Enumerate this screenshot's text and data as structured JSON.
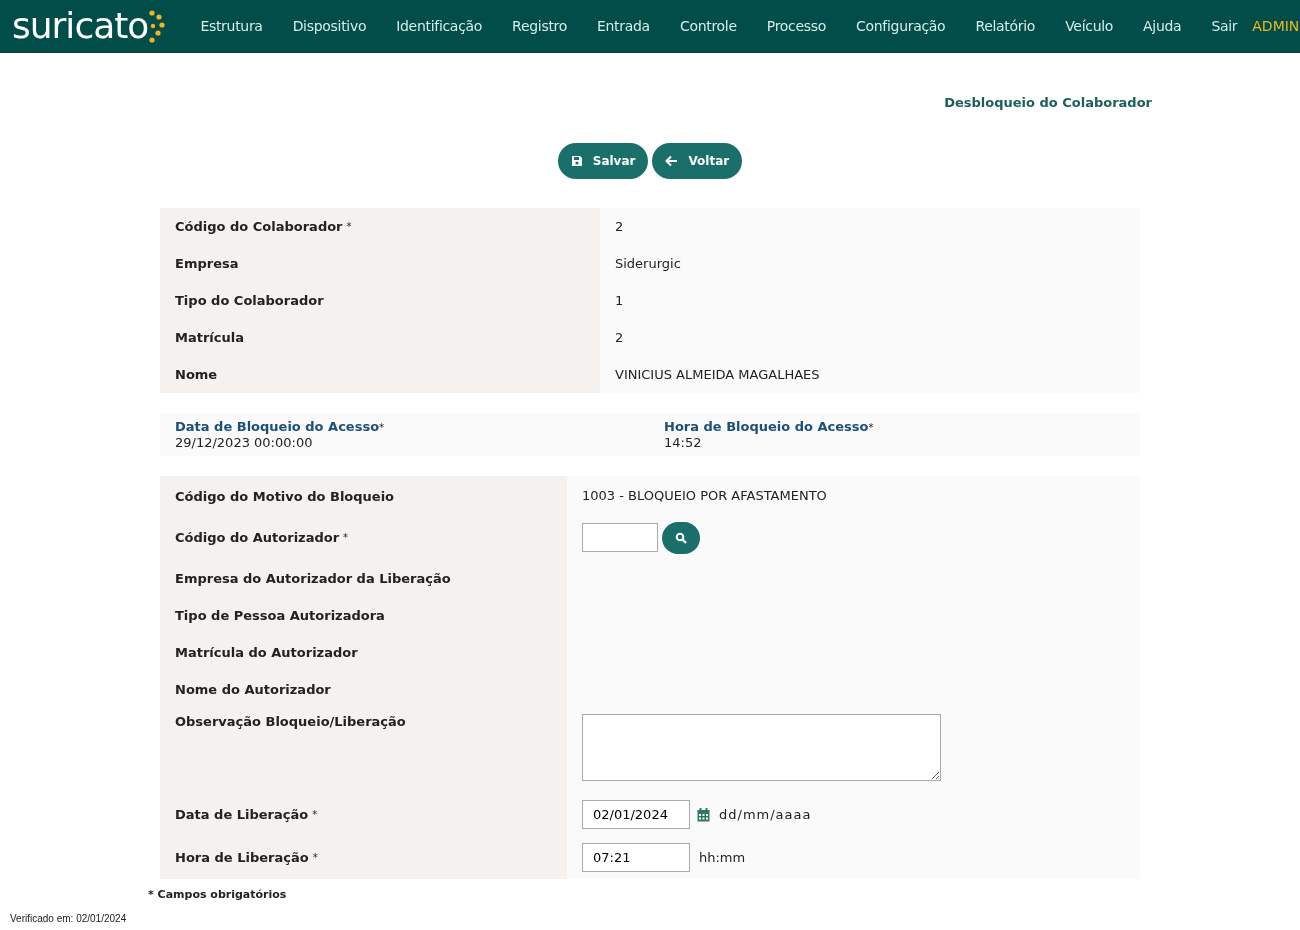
{
  "logo": {
    "text": "suricato"
  },
  "menu": [
    {
      "label": "Estrutura"
    },
    {
      "label": "Dispositivo"
    },
    {
      "label": "Identificação"
    },
    {
      "label": "Registro"
    },
    {
      "label": "Entrada"
    },
    {
      "label": "Controle"
    },
    {
      "label": "Processo"
    },
    {
      "label": "Configuração"
    },
    {
      "label": "Relatório"
    },
    {
      "label": "Veículo"
    },
    {
      "label": "Ajuda"
    },
    {
      "label": "Sair"
    }
  ],
  "user": "ADMIN",
  "page_title": "Desbloqueio do Colaborador",
  "buttons": [
    {
      "kind": "save",
      "label": "Salvar"
    },
    {
      "kind": "back",
      "label": "Voltar"
    }
  ],
  "collaborator": [
    {
      "label": "Código do Colaborador",
      "mark": "*",
      "value": "2"
    },
    {
      "label": "Empresa",
      "value": "Siderurgic"
    },
    {
      "label": "Tipo do Colaborador",
      "value": "1"
    },
    {
      "label": "Matrícula",
      "value": "2"
    },
    {
      "label": "Nome",
      "value": "VINICIUS ALMEIDA MAGALHAES"
    }
  ],
  "block": [
    {
      "label": "Data de Bloqueio do Acesso",
      "mark": "*",
      "value": "29/12/2023 00:00:00"
    },
    {
      "label": "Hora de Bloqueio do Acesso",
      "mark": "*",
      "value": "14:52"
    }
  ],
  "release": [
    {
      "kind": "text",
      "label": "Código do Motivo do Bloqueio",
      "value": "1003 - BLOQUEIO POR AFASTAMENTO"
    },
    {
      "kind": "search",
      "label": "Código do Autorizador",
      "mark": "*"
    },
    {
      "kind": "text",
      "label": "Empresa do Autorizador da Liberação"
    },
    {
      "kind": "text",
      "label": "Tipo de Pessoa Autorizadora"
    },
    {
      "kind": "text",
      "label": "Matrícula do Autorizador"
    },
    {
      "kind": "text",
      "label": "Nome do Autorizador"
    },
    {
      "kind": "textarea",
      "label": "Observação Bloqueio/Liberação"
    },
    {
      "kind": "date",
      "label": "Data de Liberação",
      "mark": "*",
      "value": "02/01/2024",
      "hint": "dd/mm/aaaa"
    },
    {
      "kind": "time",
      "label": "Hora de Liberação",
      "mark": "*",
      "value": "07:21",
      "hint": "hh:mm"
    }
  ],
  "required_note": "* Campos obrigatórios",
  "verified": "Verificado em: 02/01/2024"
}
